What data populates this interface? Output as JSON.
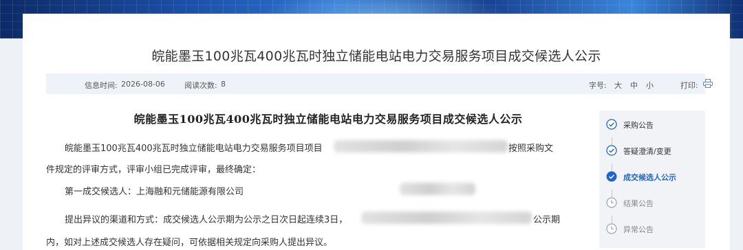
{
  "header": {
    "page_title": "皖能墨玉100兆瓦400兆瓦时独立储能电站电力交易服务项目成交候选人公示"
  },
  "info_bar": {
    "info_time_label": "信息时间:",
    "info_time_value": "2026-08-06",
    "views_label": "阅读次数:",
    "views_value": "8",
    "font_size_label": "字号:",
    "font_large": "大",
    "font_medium": "中",
    "font_small": "小",
    "print_label": "打印:",
    "print_icon": "printer-icon"
  },
  "article": {
    "title": "皖能墨玉100兆瓦400兆瓦时独立储能电站电力交易服务项目成交候选人公示",
    "para1_line1_start": "皖能墨玉100兆瓦400兆瓦时独立储能电站电力交易服务项目项目",
    "para1_line1_end": "按照采购文",
    "para1_line2": "件规定的评审方式，评审小组已完成评审，最终确定：",
    "candidate": "第一成交候选人：上海融和元储能源有限公司",
    "para3_line1_start": "提出异议的渠道和方式：成交候选人公示期为公示之日次日起连续3日，",
    "para3_line1_end": "公示期",
    "para3_line2": "内，如对上述成交候选人存在疑问，可依据相关规定向采购人提出异议。"
  },
  "sidebar": {
    "steps": [
      {
        "label": "采购公告",
        "status": "done",
        "icon": "check-circle-icon"
      },
      {
        "label": "答疑澄清/变更",
        "status": "done",
        "icon": "check-circle-icon"
      },
      {
        "label": "成交候选人公示",
        "status": "active",
        "icon": "check-circle-filled-icon"
      },
      {
        "label": "结果公告",
        "status": "pending",
        "icon": "clock-icon"
      },
      {
        "label": "异常公告",
        "status": "pending",
        "icon": "clock-icon"
      }
    ]
  },
  "colors": {
    "accent": "#2065c8",
    "info_bar_bg": "#eef2f9",
    "sidebar_bg": "#f1f3f7"
  }
}
